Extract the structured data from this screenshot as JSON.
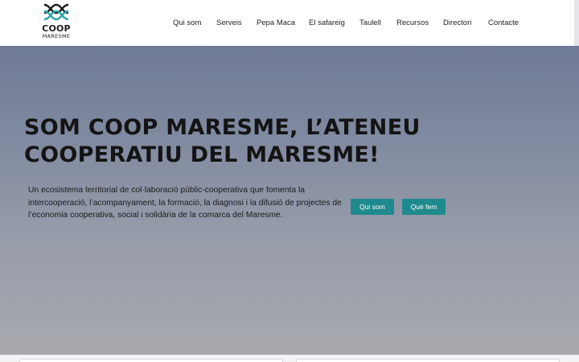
{
  "brand": {
    "name": "COOP",
    "subtitle": "MARESME"
  },
  "nav": {
    "items": [
      {
        "label": "Qui som"
      },
      {
        "label": "Serveis"
      },
      {
        "label": "Pepa Maca"
      },
      {
        "label": "El safareig"
      },
      {
        "label": "Taulell"
      },
      {
        "label": "Recursos"
      },
      {
        "label": "Directori"
      },
      {
        "label": "Contacte"
      }
    ]
  },
  "hero": {
    "headline_part1": "SOM ",
    "headline_bold": "COOP MARESME",
    "headline_part2": ", L’ATENEU COOPERATIU DEL MARESME!",
    "intro": "Un ecosistema territorial de col·laboració públic-cooperativa que fomenta la intercooperació, l’acompanyament, la formació, la diagnosi i la difusió de projectes de l’economia cooperativa, social i solidària de la comarca del Maresme.",
    "buttons": [
      {
        "label": "Qui som"
      },
      {
        "label": "Què fem"
      }
    ]
  },
  "colors": {
    "accent": "#1f8a8e",
    "hero_top": "#6f7a96",
    "hero_bottom": "#a9aaaf",
    "text": "#141414"
  }
}
